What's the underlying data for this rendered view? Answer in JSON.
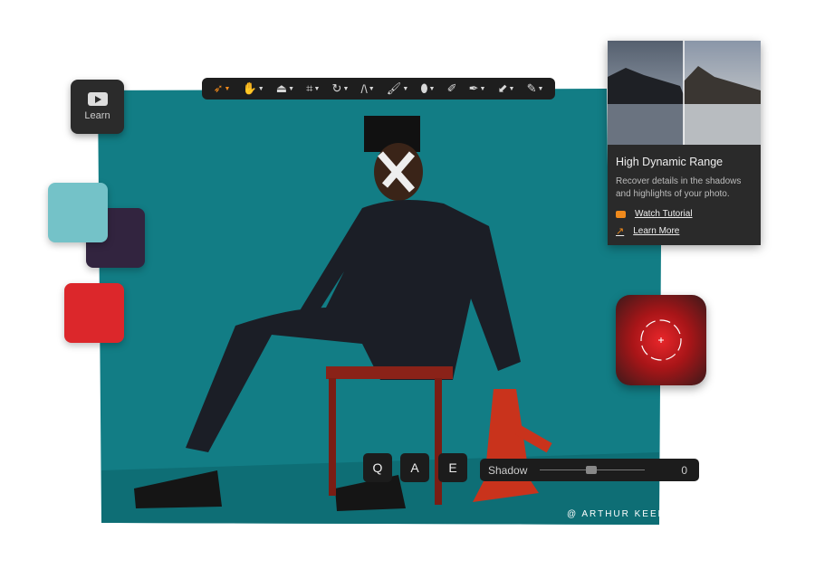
{
  "toolbar": {
    "tools": [
      {
        "icon": "select-arrow-icon",
        "active": true
      },
      {
        "icon": "hand-icon"
      },
      {
        "icon": "eraser-block-icon"
      },
      {
        "icon": "crop-icon"
      },
      {
        "icon": "rotate-icon"
      },
      {
        "icon": "perspective-icon"
      },
      {
        "icon": "brush-icon"
      },
      {
        "icon": "bandage-icon"
      },
      {
        "icon": "pencil-erase-icon"
      },
      {
        "icon": "clone-stamp-icon"
      },
      {
        "icon": "dropper-icon"
      },
      {
        "icon": "pen-icon"
      }
    ]
  },
  "learn": {
    "label": "Learn",
    "icon": "youtube-play-icon"
  },
  "swatches": {
    "colors": [
      "#74c2c8",
      "#32243f",
      "#dc272b"
    ]
  },
  "tutorial_card": {
    "title": "High Dynamic Range",
    "description": "Recover details in the shadows and highlights of your photo.",
    "watch_label": "Watch Tutorial",
    "learn_more_label": "Learn More",
    "accent": "#f08a1c"
  },
  "shortcuts": {
    "keys": [
      "Q",
      "A",
      "E"
    ]
  },
  "shadow_slider": {
    "label": "Shadow",
    "value": "0",
    "fraction": 0.5
  },
  "photo": {
    "credit": "@ ARTHUR KEEF",
    "background": "#127d85"
  }
}
